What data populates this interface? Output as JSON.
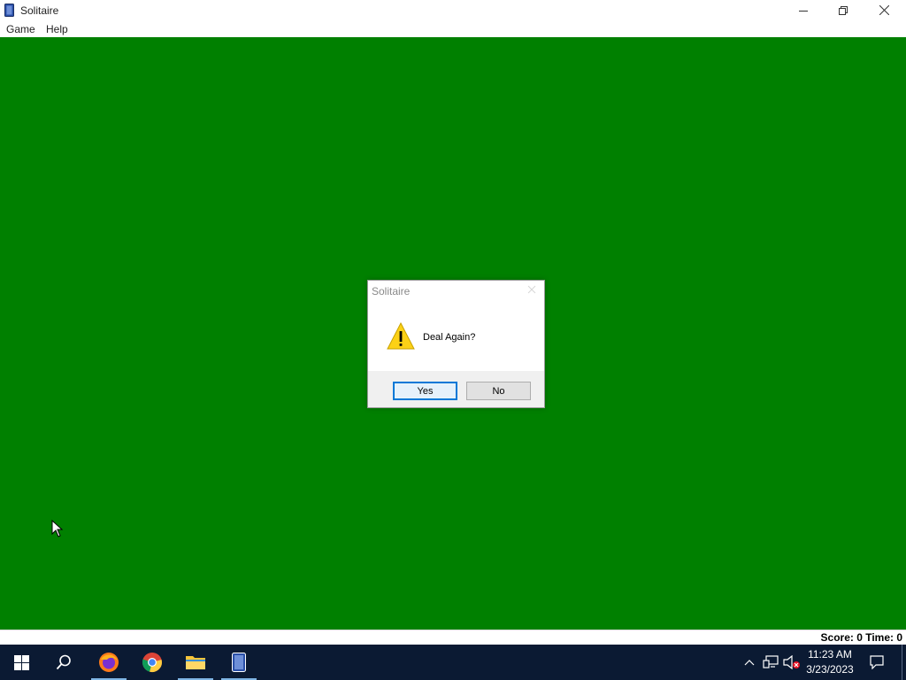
{
  "window": {
    "title": "Solitaire",
    "icon": "solitaire-card-icon"
  },
  "menu": {
    "items": [
      {
        "label": "Game"
      },
      {
        "label": "Help"
      }
    ]
  },
  "felt_color": "#008000",
  "status": {
    "text": "Score: 0 Time: 0"
  },
  "dialog": {
    "title": "Solitaire",
    "icon": "warning-icon",
    "message": "Deal Again?",
    "yes_label": "Yes",
    "no_label": "No",
    "default_button": "Yes"
  },
  "taskbar": {
    "items": [
      {
        "name": "start-button",
        "icon": "windows-logo-icon"
      },
      {
        "name": "search-button",
        "icon": "search-icon"
      },
      {
        "name": "firefox",
        "icon": "firefox-icon",
        "active": true
      },
      {
        "name": "chrome",
        "icon": "chrome-icon"
      },
      {
        "name": "file-explorer",
        "icon": "folder-icon",
        "active": true
      },
      {
        "name": "solitaire",
        "icon": "solitaire-card-icon",
        "active": true
      }
    ],
    "tray_icons": [
      "chevron-up-icon",
      "network-icon",
      "volume-muted-icon"
    ],
    "clock": {
      "time": "11:23 AM",
      "date": "3/23/2023"
    },
    "notification_icon": "action-center-icon"
  },
  "colors": {
    "felt": "#008000",
    "taskbar": "#0b1a33",
    "accent": "#0078d7"
  }
}
